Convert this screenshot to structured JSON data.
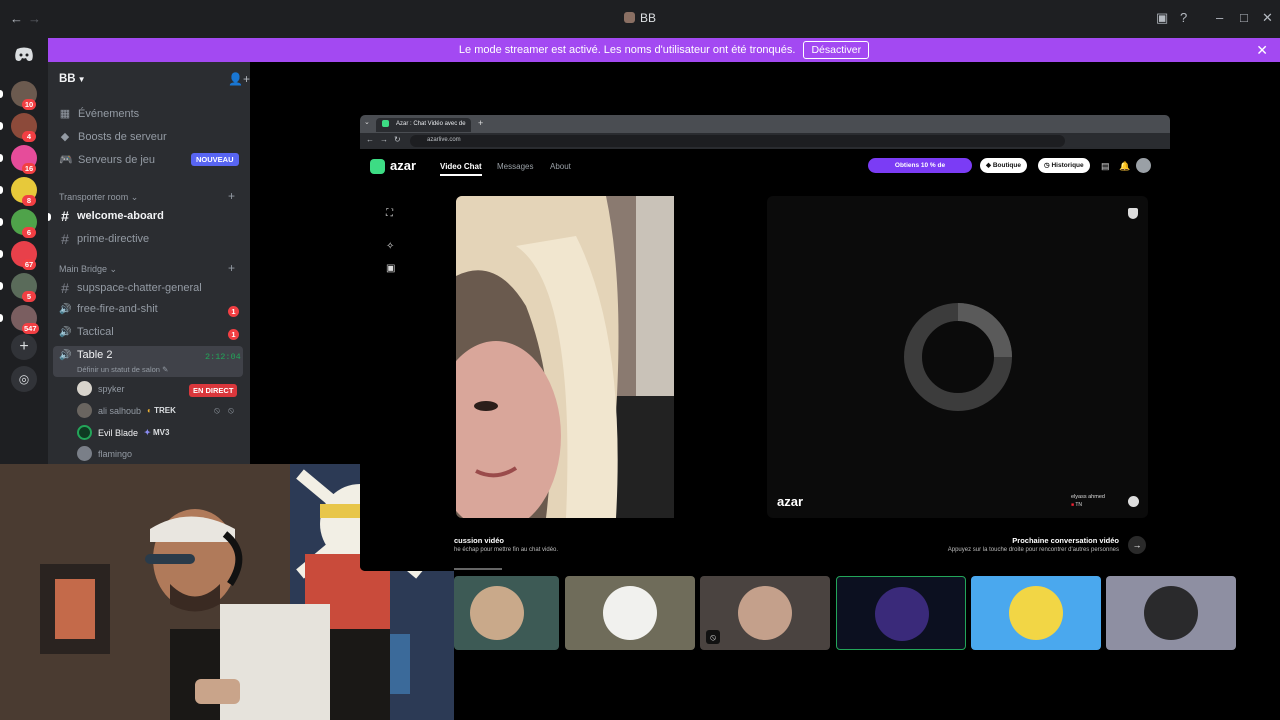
{
  "window": {
    "title": "BB",
    "back_icon": "arrow-left-icon",
    "forward_icon": "arrow-right-icon"
  },
  "banner": {
    "message": "Le mode streamer est activé. Les noms d'utilisateur ont été tronqués.",
    "button": "Désactiver"
  },
  "rail": {
    "servers": [
      {
        "badge": "10",
        "color": "#6b5a4f"
      },
      {
        "badge": "4",
        "color": "#8c4a3a"
      },
      {
        "badge": "16",
        "color": "#e64c9a"
      },
      {
        "badge": "8",
        "color": "#e7c93a"
      },
      {
        "badge": "6",
        "color": "#4fa34a"
      },
      {
        "badge": "67",
        "color": "#e8404a"
      },
      {
        "badge": "5",
        "color": "#5a6b5a"
      },
      {
        "badge": "547",
        "color": "#7a5e60"
      }
    ]
  },
  "sidebar": {
    "server_name": "BB",
    "menu": [
      {
        "label": "Événements",
        "icon": "calendar-icon"
      },
      {
        "label": "Boosts de serveur",
        "icon": "boost-icon"
      },
      {
        "label": "Serveurs de jeu",
        "icon": "gamepad-icon",
        "tag": "NOUVEAU"
      }
    ],
    "categories": [
      {
        "name": "Transporter room"
      },
      {
        "name": "Main Bridge"
      }
    ],
    "channels": [
      {
        "name": "welcome-aboard"
      },
      {
        "name": "prime-directive"
      },
      {
        "name": "supspace-chatter-general"
      },
      {
        "name": "free-fire-and-shit",
        "badge": "1"
      },
      {
        "name": "Tactical",
        "badge": "1"
      },
      {
        "name": "Table 2",
        "timer": "2:12:04",
        "status": "Définir un statut de salon"
      }
    ],
    "voice_users": [
      {
        "name": "spyker",
        "tag": "EN DIRECT"
      },
      {
        "name": "ali salhoub",
        "clan": "TREK"
      },
      {
        "name": "Evil Blade",
        "clan": "MV3"
      },
      {
        "name": "flamingo"
      }
    ]
  },
  "azar": {
    "tab_title": "Azar : Chat Vidéo avec de",
    "url": "azarlive.com",
    "brand": "azar",
    "nav": [
      "Video Chat",
      "Messages",
      "About"
    ],
    "promo": "Obtiens 10 % de",
    "shop": "Boutique",
    "history": "Historique",
    "watermark": "azar",
    "peer": "elyass ahmed",
    "peer_country": "TN",
    "footer_left_title": "cussion vidéo",
    "footer_left_sub": "he échap pour mettre fin au chat vidéo.",
    "footer_right_title": "Prochaine conversation vidéo",
    "footer_right_sub": "Appuyez sur la touche droite pour rencontrer d'autres personnes"
  },
  "tiles": [
    {
      "bg": "#3d5a55",
      "face": "#c9a98a"
    },
    {
      "bg": "#6f6c5a",
      "face": "#f1f1ee"
    },
    {
      "bg": "#4a4340",
      "face": "#c4a08b"
    },
    {
      "bg": "#0c1020",
      "face": "#3a2a7a"
    },
    {
      "bg": "#4aa8ee",
      "face": "#f2d645"
    },
    {
      "bg": "#8e8fa2",
      "face": "#2a2a2c"
    }
  ]
}
